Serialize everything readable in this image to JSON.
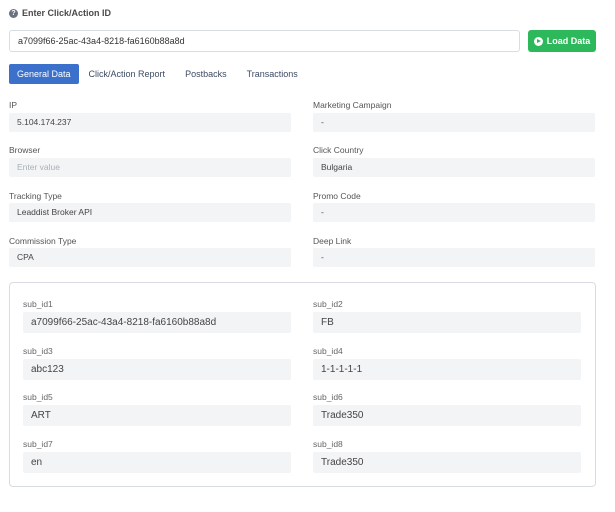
{
  "header": {
    "help_icon": "question-circle-icon",
    "title": "Enter Click/Action ID"
  },
  "search": {
    "value": "a7099f66-25ac-43a4-8218-fa6160b88a8d",
    "load_label": "Load Data",
    "load_icon": "play-circle-icon",
    "accent": "#2eb85c"
  },
  "tabs": [
    {
      "label": "General Data",
      "active": true
    },
    {
      "label": "Click/Action Report",
      "active": false
    },
    {
      "label": "Postbacks",
      "active": false
    },
    {
      "label": "Transactions",
      "active": false
    }
  ],
  "tab_accent": "#3b71ca",
  "general": {
    "ip": {
      "label": "IP",
      "value": "5.104.174.237"
    },
    "marketing_campaign": {
      "label": "Marketing Campaign",
      "value": "-"
    },
    "browser": {
      "label": "Browser",
      "placeholder": "Enter value"
    },
    "click_country": {
      "label": "Click Country",
      "value": "Bulgaria"
    },
    "tracking_type": {
      "label": "Tracking Type",
      "value": "Leaddist Broker API"
    },
    "promo_code": {
      "label": "Promo Code",
      "value": "-"
    },
    "commission_type": {
      "label": "Commission Type",
      "value": "CPA"
    },
    "deep_link": {
      "label": "Deep Link",
      "value": "-"
    }
  },
  "sub_ids": [
    {
      "label": "sub_id1",
      "value": "a7099f66-25ac-43a4-8218-fa6160b88a8d"
    },
    {
      "label": "sub_id2",
      "value": "FB"
    },
    {
      "label": "sub_id3",
      "value": "abc123"
    },
    {
      "label": "sub_id4",
      "value": "1-1-1-1-1"
    },
    {
      "label": "sub_id5",
      "value": "ART"
    },
    {
      "label": "sub_id6",
      "value": "Trade350"
    },
    {
      "label": "sub_id7",
      "value": "en"
    },
    {
      "label": "sub_id8",
      "value": "Trade350"
    }
  ]
}
